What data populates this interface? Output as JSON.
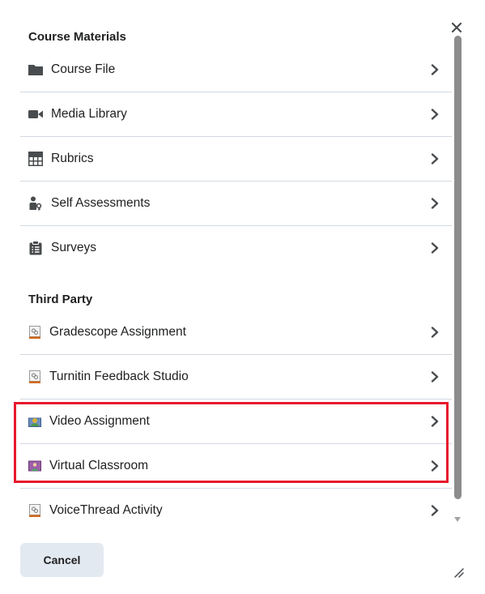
{
  "dialog": {
    "close_icon": "close-icon",
    "cancel_label": "Cancel"
  },
  "course_materials": {
    "heading": "Course Materials",
    "items": [
      {
        "label": "Course File",
        "icon": "folder-icon"
      },
      {
        "label": "Media Library",
        "icon": "video-camera-icon"
      },
      {
        "label": "Rubrics",
        "icon": "grid-icon"
      },
      {
        "label": "Self Assessments",
        "icon": "person-key-icon"
      },
      {
        "label": "Surveys",
        "icon": "clipboard-icon"
      }
    ]
  },
  "third_party": {
    "heading": "Third Party",
    "items": [
      {
        "label": "Gradescope Assignment",
        "icon": "lti-link-icon"
      },
      {
        "label": "Turnitin Feedback Studio",
        "icon": "lti-link-icon"
      },
      {
        "label": "Video Assignment",
        "icon": "video-assignment-icon"
      },
      {
        "label": "Virtual Classroom",
        "icon": "virtual-classroom-icon"
      },
      {
        "label": "VoiceThread Activity",
        "icon": "lti-link-icon"
      }
    ]
  },
  "colors": {
    "highlight": "#e8192c",
    "divider": "#d3d9e3",
    "cancel_bg": "#e3e9f1",
    "text": "#202122"
  }
}
